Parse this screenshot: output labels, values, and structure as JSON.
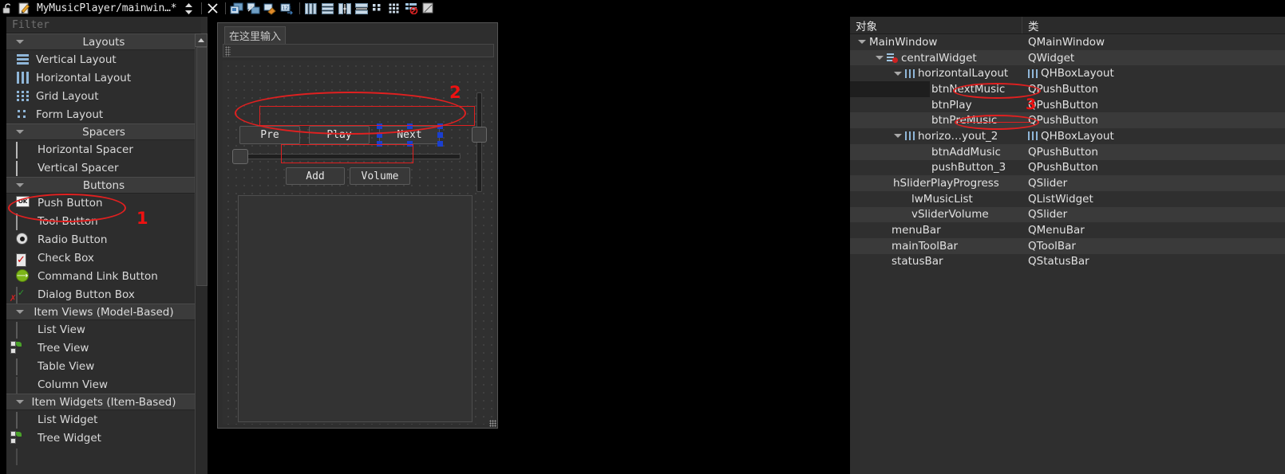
{
  "titlebar": {
    "title": "MyMusicPlayer/mainwin…*",
    "icons": [
      "unlock-icon",
      "edit-form-icon",
      "updown-spinner-icon",
      "close-icon",
      "edit-buddies-icon",
      "edit-signals-icon",
      "edit-tab-order-icon",
      "edit-widgets-icon",
      "layout-horizontal-icon",
      "layout-vertical-icon",
      "layout-splitter-h-icon",
      "layout-splitter-v-icon",
      "layout-form-icon",
      "layout-grid-icon",
      "break-layout-icon",
      "adjust-size-icon"
    ]
  },
  "widgetbox": {
    "filter_placeholder": "Filter",
    "groups": [
      {
        "label": "Layouts",
        "items": [
          {
            "label": "Vertical Layout",
            "icon": "vertical-layout-icon"
          },
          {
            "label": "Horizontal Layout",
            "icon": "horizontal-layout-icon"
          },
          {
            "label": "Grid Layout",
            "icon": "grid-layout-icon"
          },
          {
            "label": "Form Layout",
            "icon": "form-layout-icon"
          }
        ]
      },
      {
        "label": "Spacers",
        "items": [
          {
            "label": "Horizontal Spacer",
            "icon": "horizontal-spacer-icon"
          },
          {
            "label": "Vertical Spacer",
            "icon": "vertical-spacer-icon"
          }
        ]
      },
      {
        "label": "Buttons",
        "items": [
          {
            "label": "Push Button",
            "icon": "push-button-icon"
          },
          {
            "label": "Tool Button",
            "icon": "tool-button-icon"
          },
          {
            "label": "Radio Button",
            "icon": "radio-button-icon"
          },
          {
            "label": "Check Box",
            "icon": "check-box-icon"
          },
          {
            "label": "Command Link Button",
            "icon": "command-link-button-icon"
          },
          {
            "label": "Dialog Button Box",
            "icon": "dialog-button-box-icon"
          }
        ]
      },
      {
        "label": "Item Views (Model-Based)",
        "items": [
          {
            "label": "List View",
            "icon": "list-view-icon"
          },
          {
            "label": "Tree View",
            "icon": "tree-view-icon"
          },
          {
            "label": "Table View",
            "icon": "table-view-icon"
          },
          {
            "label": "Column View",
            "icon": "column-view-icon"
          }
        ]
      },
      {
        "label": "Item Widgets (Item-Based)",
        "items": [
          {
            "label": "List Widget",
            "icon": "list-widget-icon"
          },
          {
            "label": "Tree Widget",
            "icon": "tree-widget-icon"
          }
        ]
      }
    ]
  },
  "form": {
    "menu_placeholder": "在这里输入",
    "buttons_row1": [
      "Pre",
      "Play",
      "Next"
    ],
    "buttons_row2": [
      "Add",
      "Volume"
    ]
  },
  "object_inspector": {
    "columns": [
      "对象",
      "类"
    ],
    "rows": [
      {
        "object": "MainWindow",
        "class": "QMainWindow",
        "indent": 0,
        "expander": true,
        "icon": "",
        "class_icon": "",
        "shade": "norm",
        "selected": false
      },
      {
        "object": "centralWidget",
        "class": "QWidget",
        "indent": 1,
        "expander": true,
        "icon": "break-layout-icon",
        "class_icon": "",
        "shade": "alt",
        "selected": false
      },
      {
        "object": "horizontalLayout",
        "class": "QHBoxLayout",
        "indent": 2,
        "expander": true,
        "icon": "hbox-layout-icon",
        "class_icon": "hbox-layout-icon",
        "shade": "norm",
        "selected": false
      },
      {
        "object": "btnNextMusic",
        "class": "QPushButton",
        "indent": 4,
        "expander": false,
        "icon": "",
        "class_icon": "",
        "shade": "norm",
        "selected": true
      },
      {
        "object": "btnPlay",
        "class": "QPushButton",
        "indent": 4,
        "expander": false,
        "icon": "",
        "class_icon": "",
        "shade": "norm",
        "selected": false
      },
      {
        "object": "btnPreMusic",
        "class": "QPushButton",
        "indent": 4,
        "expander": false,
        "icon": "",
        "class_icon": "",
        "shade": "alt",
        "selected": false
      },
      {
        "object": "horizo…yout_2",
        "class": "QHBoxLayout",
        "indent": 2,
        "expander": true,
        "icon": "hbox-layout-icon",
        "class_icon": "hbox-layout-icon",
        "shade": "norm",
        "selected": false
      },
      {
        "object": "btnAddMusic",
        "class": "QPushButton",
        "indent": 4,
        "expander": false,
        "icon": "",
        "class_icon": "",
        "shade": "alt",
        "selected": false
      },
      {
        "object": "pushButton_3",
        "class": "QPushButton",
        "indent": 4,
        "expander": false,
        "icon": "",
        "class_icon": "",
        "shade": "norm",
        "selected": false
      },
      {
        "object": "hSliderPlayProgress",
        "class": "QSlider",
        "indent": 3,
        "expander": false,
        "icon": "",
        "class_icon": "",
        "shade": "alt",
        "selected": false
      },
      {
        "object": "lwMusicList",
        "class": "QListWidget",
        "indent": 3,
        "expander": false,
        "icon": "",
        "class_icon": "",
        "shade": "norm",
        "selected": false
      },
      {
        "object": "vSliderVolume",
        "class": "QSlider",
        "indent": 3,
        "expander": false,
        "icon": "",
        "class_icon": "",
        "shade": "alt",
        "selected": false
      },
      {
        "object": "menuBar",
        "class": "QMenuBar",
        "indent": 2,
        "expander": false,
        "icon": "",
        "class_icon": "",
        "shade": "norm",
        "selected": false
      },
      {
        "object": "mainToolBar",
        "class": "QToolBar",
        "indent": 2,
        "expander": false,
        "icon": "",
        "class_icon": "",
        "shade": "alt",
        "selected": false
      },
      {
        "object": "statusBar",
        "class": "QStatusBar",
        "indent": 2,
        "expander": false,
        "icon": "",
        "class_icon": "",
        "shade": "norm",
        "selected": false
      }
    ]
  },
  "annotations": {
    "color": "#e02020",
    "marks": [
      {
        "name": "push-button-callout",
        "number": "1"
      },
      {
        "name": "buttons-row-callout",
        "number": "2"
      },
      {
        "name": "object-names-callout",
        "number": "3"
      }
    ]
  }
}
